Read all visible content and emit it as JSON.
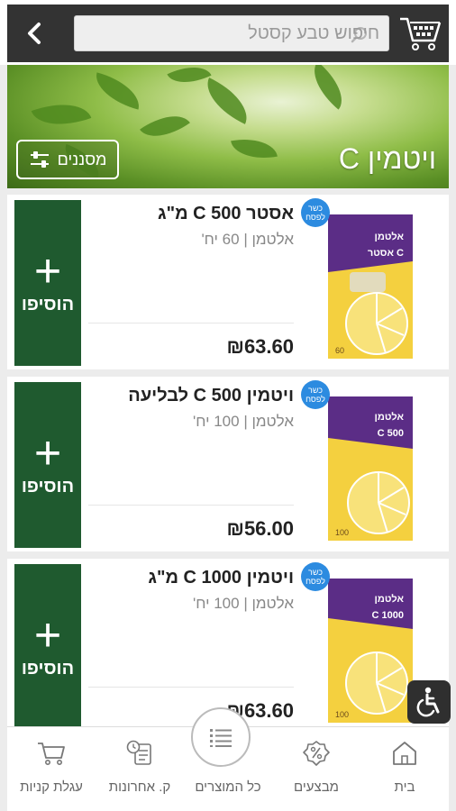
{
  "header": {
    "search_placeholder": "חיפוש טבע קסטל",
    "icons": {
      "back": "chevron-left-icon",
      "search": "search-icon",
      "cart": "cart-icon"
    }
  },
  "banner": {
    "title": "ויטמין C",
    "filter_label": "מסננים"
  },
  "add_button_label": "הוסיפו",
  "kosher_label": "כשר לפסח",
  "products": [
    {
      "name": "אסטר C 500 מ\"ג",
      "brand": "אלטמן | 60 יח'",
      "price": "₪63.60",
      "pack_label": "אסטר C",
      "count": "60"
    },
    {
      "name": "ויטמין C 500 לבליעה",
      "brand": "אלטמן | 100 יח'",
      "price": "₪56.00",
      "pack_label": "C 500",
      "count": "100"
    },
    {
      "name": "ויטמין C 1000 מ\"ג",
      "brand": "אלטמן | 100 יח'",
      "price": "₪63.60",
      "pack_label": "C 1000",
      "count": "100"
    }
  ],
  "bottom_nav": {
    "home": "בית",
    "deals": "מבצעים",
    "all_products": "כל המוצרים",
    "recent": "ק. אחרונות",
    "cart": "עגלת קניות"
  },
  "colors": {
    "add_button": "#1f5a2f",
    "top_bar": "#333333",
    "kosher_badge": "#2c8be0",
    "pack_purple": "#5b2d86",
    "pack_yellow": "#f4d03f"
  }
}
